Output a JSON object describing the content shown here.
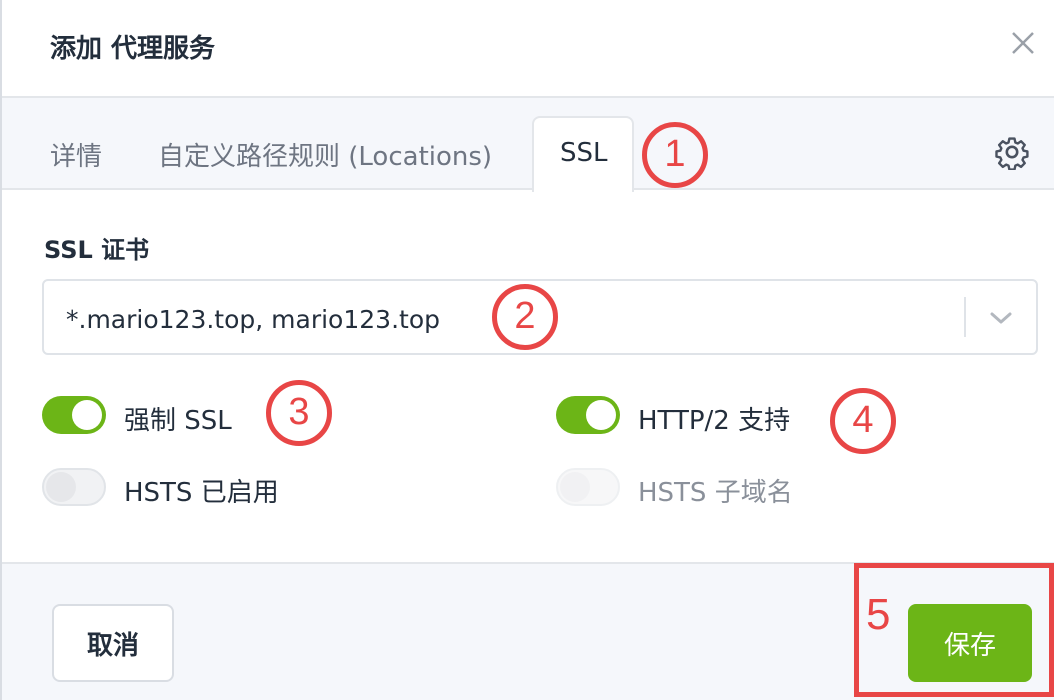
{
  "dialog": {
    "title": "添加 代理服务",
    "close_icon": "close-icon"
  },
  "tabs": [
    {
      "label": "详情",
      "active": false
    },
    {
      "label": "自定义路径规则 (Locations)",
      "active": false
    },
    {
      "label": "SSL",
      "active": true
    }
  ],
  "settings_icon": "gear-icon",
  "ssl": {
    "certificate_label": "SSL 证书",
    "certificate_value": "*.mario123.top, mario123.top",
    "toggles": [
      {
        "label": "强制 SSL",
        "on": true,
        "disabled": false
      },
      {
        "label": "HTTP/2 支持",
        "on": true,
        "disabled": false
      },
      {
        "label": "HSTS 已启用",
        "on": false,
        "disabled": false
      },
      {
        "label": "HSTS 子域名",
        "on": false,
        "disabled": true
      }
    ]
  },
  "footer": {
    "cancel_label": "取消",
    "save_label": "保存"
  },
  "annotations": {
    "markers": [
      "1",
      "2",
      "3",
      "4",
      "5"
    ],
    "color": "#e84646"
  },
  "colors": {
    "accent_green": "#6cb517",
    "annotation_red": "#e84646"
  }
}
